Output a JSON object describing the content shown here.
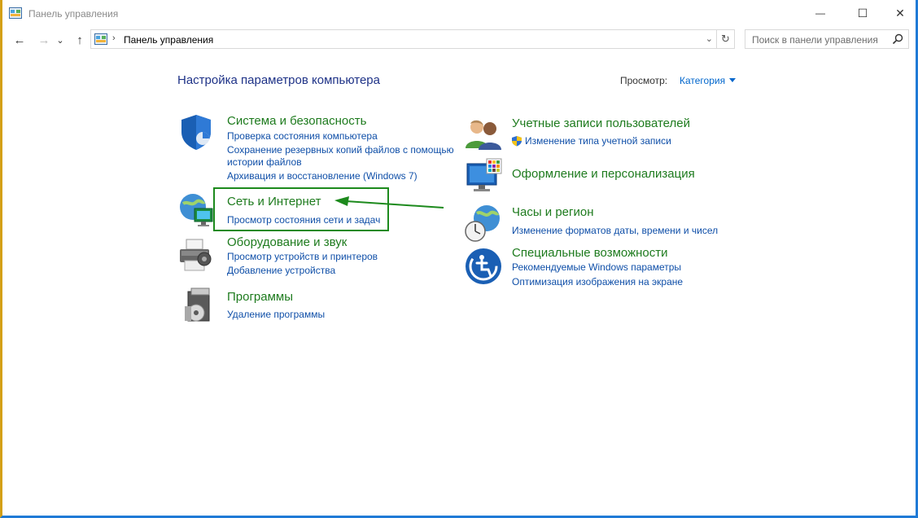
{
  "window": {
    "title": "Панель управления",
    "minimize_glyph": "—",
    "maximize_glyph": "☐",
    "close_glyph": "✕"
  },
  "nav": {
    "back_glyph": "←",
    "forward_glyph": "→",
    "recent_glyph": "⌄",
    "up_glyph": "↑"
  },
  "address": {
    "separator": "›",
    "path": "Панель управления",
    "dropdown_glyph": "⌄",
    "refresh_glyph": "↻"
  },
  "search": {
    "placeholder": "Поиск в панели управления"
  },
  "main": {
    "heading": "Настройка параметров компьютера",
    "view_by_label": "Просмотр:",
    "view_by_value": "Категория"
  },
  "categories_left": [
    {
      "title": "Система и безопасность",
      "icon": "shield-icon",
      "links": [
        "Проверка состояния компьютера",
        "Сохранение резервных копий файлов с помощью",
        "истории файлов",
        "Архивация и восстановление (Windows 7)"
      ]
    },
    {
      "title": "Сеть и Интернет",
      "icon": "network-globe-icon",
      "links": [
        "Просмотр состояния сети и задач"
      ]
    },
    {
      "title": "Оборудование и звук",
      "icon": "printer-icon",
      "links": [
        "Просмотр устройств и принтеров",
        "Добавление устройства"
      ]
    },
    {
      "title": "Программы",
      "icon": "programs-disc-icon",
      "links": [
        "Удаление программы"
      ]
    }
  ],
  "categories_right": [
    {
      "title": "Учетные записи пользователей",
      "icon": "users-icon",
      "links": [
        "Изменение типа учетной записи"
      ]
    },
    {
      "title": "Оформление и персонализация",
      "icon": "monitor-palette-icon",
      "links": []
    },
    {
      "title": "Часы и регион",
      "icon": "clock-globe-icon",
      "links": [
        "Изменение форматов даты, времени и чисел"
      ]
    },
    {
      "title": "Специальные возможности",
      "icon": "accessibility-icon",
      "links": [
        "Рекомендуемые Windows параметры",
        "Оптимизация изображения на экране"
      ]
    }
  ],
  "colors": {
    "category_title": "#1e7b1e",
    "link": "#0f4fa8",
    "heading": "#1e3287",
    "annotation": "#1d8a1d"
  }
}
